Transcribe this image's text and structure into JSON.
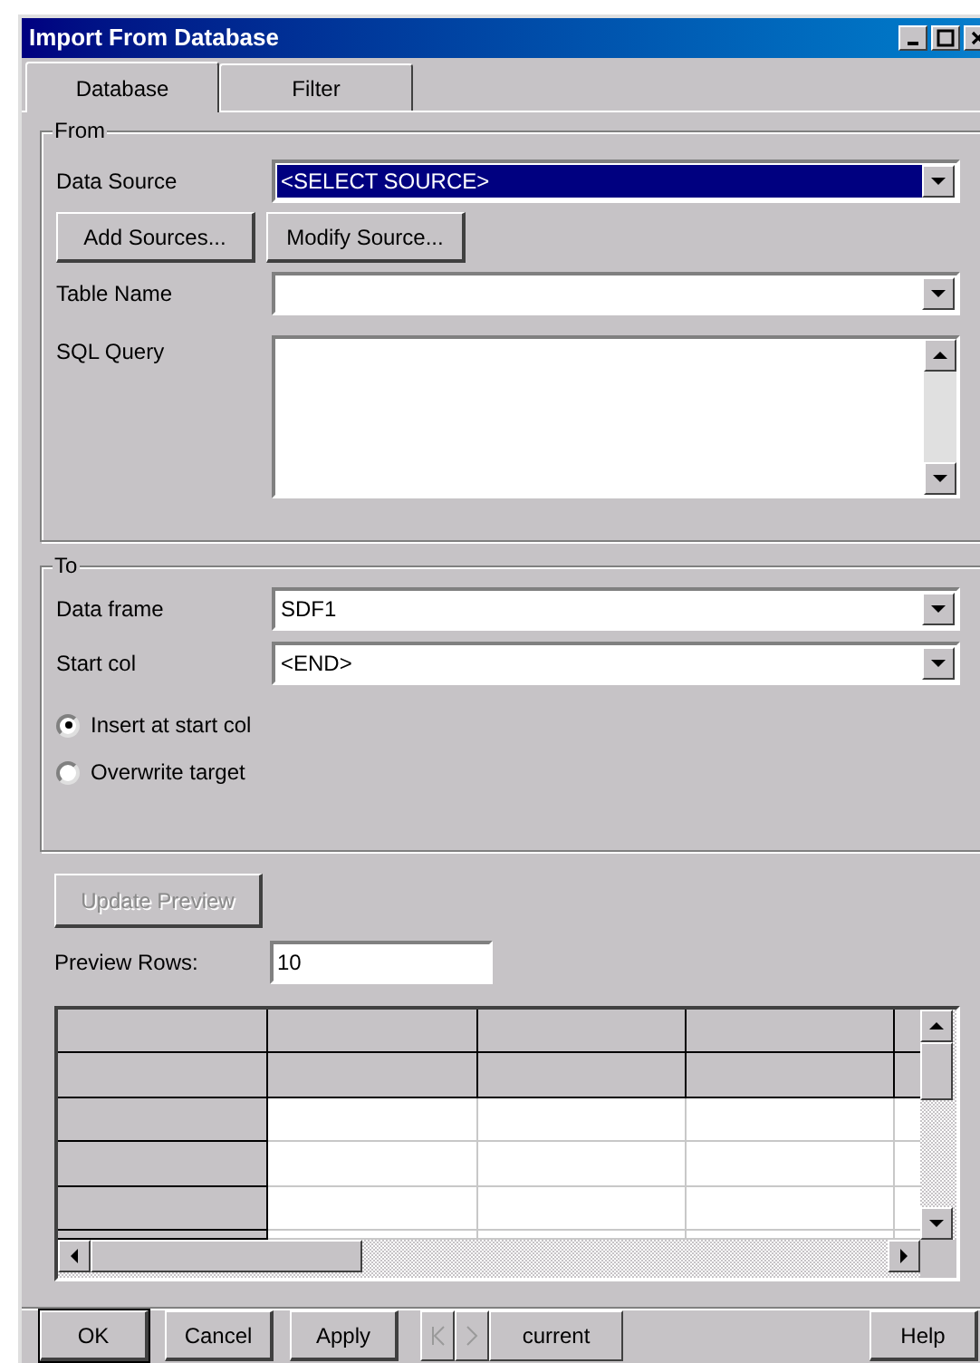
{
  "window": {
    "title": "Import From Database"
  },
  "tabs": [
    {
      "label": "Database",
      "selected": true
    },
    {
      "label": "Filter",
      "selected": false
    }
  ],
  "from": {
    "legend": "From",
    "data_source": {
      "label": "Data Source",
      "value": "<SELECT SOURCE>",
      "selected": true
    },
    "buttons": [
      "Add Sources...",
      "Modify Source..."
    ],
    "table_name": {
      "label": "Table Name"
    },
    "sql_query": {
      "label": "SQL Query"
    }
  },
  "to": {
    "legend": "To",
    "data_frame": {
      "label": "Data frame",
      "value": "SDF1"
    },
    "start_col": {
      "label": "Start col",
      "value": "<END>"
    },
    "radios": [
      {
        "label": "Insert at start col",
        "selected": true
      },
      {
        "label": "Overwrite target",
        "selected": false
      }
    ]
  },
  "update_preview": {
    "label": "Update Preview",
    "disabled": true
  },
  "preview_rows": {
    "label": "Preview Rows:",
    "value": "10"
  },
  "footer": {
    "buttons": [
      "OK",
      "Cancel",
      "Apply"
    ],
    "nav_disabled": true,
    "record": "current",
    "help": "Help"
  }
}
